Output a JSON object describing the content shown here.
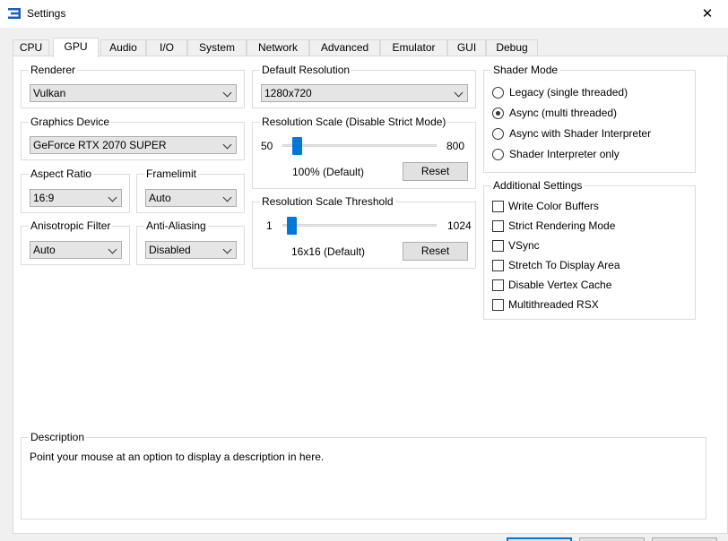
{
  "window": {
    "title": "Settings",
    "close_glyph": "✕"
  },
  "tabs": [
    {
      "label": "CPU"
    },
    {
      "label": "GPU"
    },
    {
      "label": "Audio"
    },
    {
      "label": "I/O"
    },
    {
      "label": "System"
    },
    {
      "label": "Network"
    },
    {
      "label": "Advanced"
    },
    {
      "label": "Emulator"
    },
    {
      "label": "GUI"
    },
    {
      "label": "Debug"
    }
  ],
  "active_tab": "GPU",
  "renderer": {
    "title": "Renderer",
    "value": "Vulkan"
  },
  "graphics_device": {
    "title": "Graphics Device",
    "value": "GeForce RTX 2070 SUPER"
  },
  "aspect_ratio": {
    "title": "Aspect Ratio",
    "value": "16:9"
  },
  "framelimit": {
    "title": "Framelimit",
    "value": "Auto"
  },
  "anisotropic_filter": {
    "title": "Anisotropic Filter",
    "value": "Auto"
  },
  "anti_aliasing": {
    "title": "Anti-Aliasing",
    "value": "Disabled"
  },
  "default_resolution": {
    "title": "Default Resolution",
    "value": "1280x720"
  },
  "resolution_scale": {
    "title": "Resolution Scale (Disable Strict Mode)",
    "min": "50",
    "max": "800",
    "current": "100% (Default)",
    "reset_label": "Reset",
    "position": 0.07
  },
  "resolution_scale_threshold": {
    "title": "Resolution Scale Threshold",
    "min": "1",
    "max": "1024",
    "current": "16x16 (Default)",
    "reset_label": "Reset",
    "position": 0.03
  },
  "shader_mode": {
    "title": "Shader Mode",
    "options": [
      {
        "label": "Legacy (single threaded)",
        "checked": false
      },
      {
        "label": "Async (multi threaded)",
        "checked": true
      },
      {
        "label": "Async with Shader Interpreter",
        "checked": false
      },
      {
        "label": "Shader Interpreter only",
        "checked": false
      }
    ]
  },
  "additional_settings": {
    "title": "Additional Settings",
    "options": [
      {
        "label": "Write Color Buffers",
        "checked": false
      },
      {
        "label": "Strict Rendering Mode",
        "checked": false
      },
      {
        "label": "VSync",
        "checked": false
      },
      {
        "label": "Stretch To Display Area",
        "checked": false
      },
      {
        "label": "Disable Vertex Cache",
        "checked": false
      },
      {
        "label": "Multithreaded RSX",
        "checked": false
      }
    ]
  },
  "description": {
    "title": "Description",
    "text": "Point your mouse at an option to display a description in here."
  },
  "colors": {
    "accent": "#0078d7",
    "border": "#dcdcdc",
    "combo_bg": "#e5e5e5",
    "button_bg": "#e1e1e1"
  }
}
